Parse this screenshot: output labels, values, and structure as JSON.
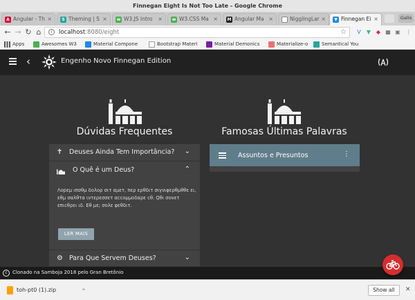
{
  "window": {
    "title": "Finnegan Eight Is Not Too Late - Google Chrome"
  },
  "tabs": [
    {
      "label": "Angular - Th",
      "favicon": "angular-icon",
      "color": "#dd0031",
      "active": false
    },
    {
      "label": "Theming | S",
      "favicon": "s-icon",
      "color": "#26a69a",
      "active": false
    },
    {
      "label": "W3.JS Intro",
      "favicon": "w3-icon",
      "color": "#4caf50",
      "active": false
    },
    {
      "label": "W3.CSS Ma",
      "favicon": "w3-icon",
      "color": "#4caf50",
      "active": false
    },
    {
      "label": "Angular Ma",
      "favicon": "m-icon",
      "color": "#222222",
      "active": false
    },
    {
      "label": "NigglingLar",
      "favicon": "page-icon",
      "color": "#888888",
      "active": false
    },
    {
      "label": "Finnegan Ei",
      "favicon": "bookmark-icon",
      "color": "#1e88e5",
      "active": true
    }
  ],
  "user_chip": "Gallo",
  "address": {
    "host": "localhost",
    "port_path": ":8080/eight"
  },
  "bookmarks": [
    {
      "label": "Apps",
      "icon": "apps-grid-icon",
      "color": "#555555"
    },
    {
      "label": "Awesomes W3",
      "icon": "w3-icon",
      "color": "#4caf50"
    },
    {
      "label": "Material Compone",
      "icon": "bookmark-icon",
      "color": "#1e88e5"
    },
    {
      "label": "Bootstrap Materi",
      "icon": "page-icon",
      "color": "#999999"
    },
    {
      "label": "Material Demonics",
      "icon": "mdl-icon",
      "color": "#7b1fa2"
    },
    {
      "label": "Materialize-o",
      "icon": "bookmark-icon",
      "color": "#ee6e73"
    },
    {
      "label": "Semantical You",
      "icon": "s-icon",
      "color": "#26a69a"
    }
  ],
  "app": {
    "title": "Engenho Novo Finnegan Edition",
    "faq": {
      "heading": "Dúvidas Frequentes",
      "items": [
        {
          "label": "Deuses Ainda Tem Importância?",
          "icon": "cross-icon",
          "expanded": false
        },
        {
          "label": "O Quê é um Deus?",
          "icon": "mosque-icon",
          "expanded": true
        },
        {
          "label": "Para Que Servem Deuses?",
          "icon": "gear-icon",
          "expanded": false
        }
      ],
      "body": "Λοрεμ ιπσθμ δολορ σιτ αμετ, περ ερθδιτ σιγνιφερθμθθε ει, εθμ σαλθτα ιντερεσσετ αccομμοδαρε cθ. Qθι σονετ επιcθρει ιδ. Εθ με; σολε φεθδιτ.",
      "read_more": "LER MAIS"
    },
    "last_words": {
      "heading": "Famosas Últimas Palavras",
      "card_title": "Assuntos e Presuntos"
    },
    "footer": "Clonado na Samboja 2018 pelo Gran Bretônio",
    "fab_icon": "bicycle-icon"
  },
  "downloads": {
    "file": "toh-pt0 (1).zip",
    "show_all": "Show all"
  }
}
